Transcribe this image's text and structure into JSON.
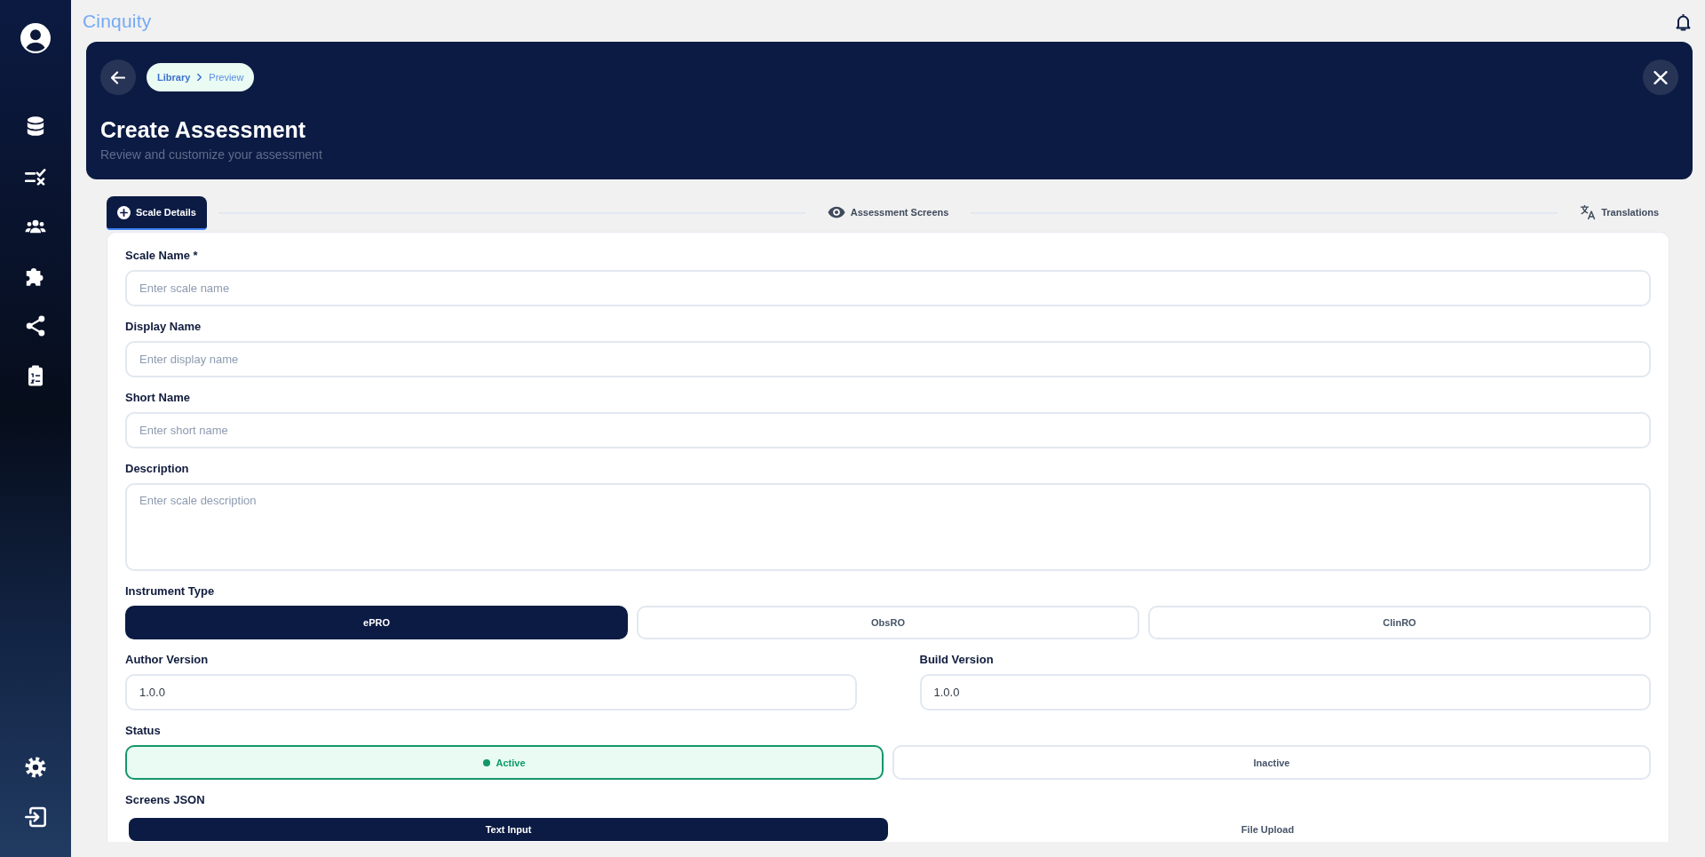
{
  "app": {
    "logo": "Cinquity"
  },
  "header": {
    "breadcrumb": [
      "Library",
      "Preview"
    ],
    "title": "Create Assessment",
    "subtitle": "Review and customize your assessment"
  },
  "steps": [
    {
      "label": "Scale Details",
      "selected": true
    },
    {
      "label": "Assessment Screens",
      "selected": false
    },
    {
      "label": "Translations",
      "selected": false
    }
  ],
  "form": {
    "fields": [
      {
        "kind": "input",
        "label": "Scale Name *",
        "placeholder": "Enter scale name"
      },
      {
        "kind": "input",
        "label": "Display Name",
        "placeholder": "Enter display name"
      },
      {
        "kind": "input",
        "label": "Short Name",
        "placeholder": "Enter short name"
      },
      {
        "kind": "textarea",
        "label": "Description",
        "placeholder": "Enter scale description"
      }
    ],
    "instrument_type": {
      "label": "Instrument Type",
      "options": [
        {
          "label": "ePRO",
          "selected": true
        },
        {
          "label": "ObsRO",
          "selected": false
        },
        {
          "label": "ClinRO",
          "selected": false
        }
      ]
    },
    "versions": [
      {
        "label": "Author Version",
        "value": "1.0.0"
      },
      {
        "label": "Build Version",
        "value": "1.0.0"
      }
    ],
    "status": {
      "label": "Status",
      "options": [
        {
          "label": "Active",
          "selected": true
        },
        {
          "label": "Inactive",
          "selected": false
        }
      ]
    },
    "screens_json": {
      "label": "Screens JSON",
      "tabs": [
        {
          "label": "Text Input",
          "selected": true
        },
        {
          "label": "File Upload",
          "selected": false
        }
      ]
    }
  }
}
